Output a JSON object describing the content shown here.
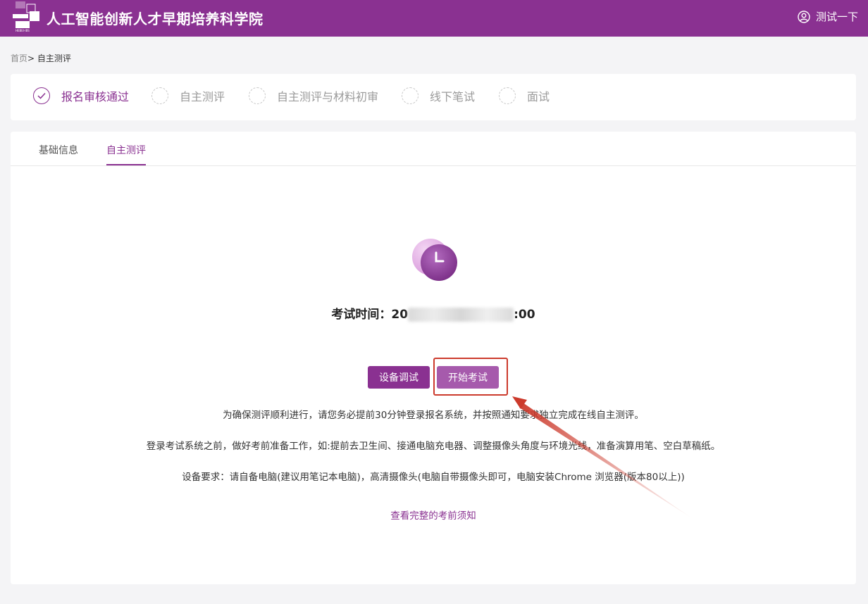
{
  "header": {
    "title": "人工智能创新人才早期培养科学院",
    "user_name": "测试一下",
    "logo_caption": "HEBEI-IBS"
  },
  "breadcrumb": {
    "home": "首页",
    "separator": ">",
    "current": "自主测评"
  },
  "steps": [
    {
      "label": "报名审核通过",
      "status": "done"
    },
    {
      "label": "自主测评",
      "status": "pending"
    },
    {
      "label": "自主测评与材料初审",
      "status": "pending"
    },
    {
      "label": "线下笔试",
      "status": "pending"
    },
    {
      "label": "面试",
      "status": "pending"
    }
  ],
  "tabs": [
    {
      "label": "基础信息",
      "active": false
    },
    {
      "label": "自主测评",
      "active": true
    }
  ],
  "exam": {
    "time_label": "考试时间：",
    "time_value_visible_prefix": "20",
    "time_value_visible_suffix": ":00"
  },
  "buttons": {
    "device_check": "设备调试",
    "start_exam": "开始考试"
  },
  "notices": [
    "为确保测评顺利进行，请您务必提前30分钟登录报名系统，并按照通知要求独立完成在线自主测评。",
    "登录考试系统之前，做好考前准备工作，如:提前去卫生间、接通电脑充电器、调整摄像头角度与环境光线，准备演算用笔、空白草稿纸。",
    "设备要求：请自备电脑(建议用笔记本电脑)，高清摄像头(电脑自带摄像头即可，电脑安装Chrome 浏览器(版本80以上))"
  ],
  "link": "查看完整的考前须知",
  "colors": {
    "primary": "#8a3191",
    "primary_light": "#a65aac",
    "annotation": "#cc3a2c",
    "background": "#f4f4f6"
  },
  "icons": {
    "user": "user-circle-icon",
    "step_done": "check-circle-icon",
    "clock": "clock-icon"
  }
}
